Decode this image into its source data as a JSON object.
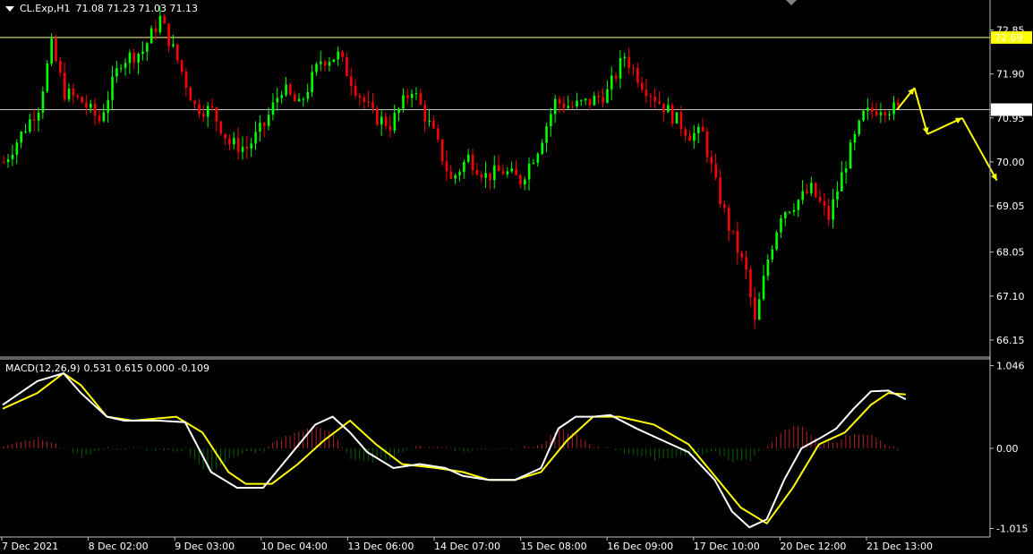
{
  "header": {
    "symbol_timeframe": "CL.Exp,H1",
    "ohlc": "71.08 71.23 71.03 71.13"
  },
  "macd_header": {
    "label": "MACD(12,26,9)",
    "values": "0.531 0.615 0.000 -0.109"
  },
  "colors": {
    "background": "#000000",
    "bull_candle": "#00ff00",
    "bear_candle": "#ff0000",
    "macd_line": "#ffffff",
    "signal_line": "#ffff00",
    "hist_pos": "#b22222",
    "hist_neg": "#006400",
    "level_line": "#ffff80",
    "price_line": "#c0c0c0",
    "arrow": "#ffff00"
  },
  "chart_data": [
    {
      "type": "candlestick",
      "symbol": "CL.Exp",
      "timeframe": "H1",
      "ylim": [
        65.8,
        73.5
      ],
      "y_ticks": [
        "72.85",
        "71.90",
        "70.95",
        "70.00",
        "69.05",
        "68.05",
        "67.10",
        "66.15"
      ],
      "y_tick_values": [
        72.85,
        71.9,
        70.95,
        70.0,
        69.05,
        68.05,
        67.1,
        66.15
      ],
      "x_ticks": [
        "7 Dec 2021",
        "8 Dec 02:00",
        "9 Dec 03:00",
        "10 Dec 04:00",
        "13 Dec 06:00",
        "14 Dec 07:00",
        "15 Dec 08:00",
        "16 Dec 09:00",
        "17 Dec 10:00",
        "20 Dec 12:00",
        "21 Dec 13:00"
      ],
      "horizontal_level": {
        "value": 72.69,
        "label": "72.69"
      },
      "current_price": {
        "value": 71.13,
        "label": "71.13"
      },
      "price_path": [
        [
          0,
          70.0
        ],
        [
          8,
          71.2
        ],
        [
          11,
          72.5
        ],
        [
          14,
          71.5
        ],
        [
          18,
          71.3
        ],
        [
          22,
          70.9
        ],
        [
          27,
          72.2
        ],
        [
          32,
          72.4
        ],
        [
          36,
          73.1
        ],
        [
          40,
          72.2
        ],
        [
          44,
          71.2
        ],
        [
          48,
          71.1
        ],
        [
          52,
          70.4
        ],
        [
          56,
          70.3
        ],
        [
          60,
          70.8
        ],
        [
          64,
          71.6
        ],
        [
          68,
          71.2
        ],
        [
          73,
          72.2
        ],
        [
          77,
          72.3
        ],
        [
          81,
          71.6
        ],
        [
          85,
          71.0
        ],
        [
          89,
          70.8
        ],
        [
          94,
          71.6
        ],
        [
          99,
          70.6
        ],
        [
          103,
          69.6
        ],
        [
          107,
          70.1
        ],
        [
          111,
          69.7
        ],
        [
          115,
          69.8
        ],
        [
          119,
          69.6
        ],
        [
          123,
          70.3
        ],
        [
          127,
          71.3
        ],
        [
          131,
          71.2
        ],
        [
          135,
          71.3
        ],
        [
          139,
          71.5
        ],
        [
          143,
          72.3
        ],
        [
          147,
          71.7
        ],
        [
          151,
          71.3
        ],
        [
          154,
          71.0
        ],
        [
          158,
          70.6
        ],
        [
          161,
          70.6
        ],
        [
          164,
          69.5
        ],
        [
          167,
          68.6
        ],
        [
          171,
          67.6
        ],
        [
          173,
          66.5
        ],
        [
          176,
          67.9
        ],
        [
          179,
          68.9
        ],
        [
          182,
          69.1
        ],
        [
          186,
          69.4
        ],
        [
          190,
          68.8
        ],
        [
          194,
          70.0
        ],
        [
          198,
          71.0
        ],
        [
          202,
          71.2
        ],
        [
          206,
          71.13
        ]
      ],
      "forecast_arrow": [
        [
          206,
          71.13
        ],
        [
          210,
          71.6
        ],
        [
          213,
          70.6
        ],
        [
          221,
          70.95
        ],
        [
          229,
          69.6
        ]
      ]
    },
    {
      "type": "macd",
      "params": [
        12,
        26,
        9
      ],
      "ylim": [
        -1.1,
        1.12
      ],
      "y_ticks": [
        "1.046",
        "0.00",
        "-1.015"
      ],
      "y_tick_values": [
        1.046,
        0.0,
        -1.015
      ],
      "macd_path": [
        [
          0,
          0.55
        ],
        [
          8,
          0.85
        ],
        [
          14,
          0.95
        ],
        [
          18,
          0.7
        ],
        [
          24,
          0.4
        ],
        [
          28,
          0.35
        ],
        [
          36,
          0.35
        ],
        [
          42,
          0.33
        ],
        [
          48,
          -0.3
        ],
        [
          54,
          -0.5
        ],
        [
          60,
          -0.5
        ],
        [
          66,
          -0.1
        ],
        [
          72,
          0.3
        ],
        [
          76,
          0.4
        ],
        [
          80,
          0.2
        ],
        [
          84,
          -0.05
        ],
        [
          90,
          -0.25
        ],
        [
          96,
          -0.2
        ],
        [
          102,
          -0.25
        ],
        [
          106,
          -0.35
        ],
        [
          112,
          -0.4
        ],
        [
          118,
          -0.4
        ],
        [
          124,
          -0.25
        ],
        [
          128,
          0.25
        ],
        [
          132,
          0.4
        ],
        [
          136,
          0.4
        ],
        [
          140,
          0.42
        ],
        [
          146,
          0.25
        ],
        [
          152,
          0.1
        ],
        [
          158,
          -0.05
        ],
        [
          164,
          -0.4
        ],
        [
          168,
          -0.8
        ],
        [
          172,
          -1.0
        ],
        [
          176,
          -0.9
        ],
        [
          180,
          -0.4
        ],
        [
          184,
          0.0
        ],
        [
          188,
          0.12
        ],
        [
          192,
          0.25
        ],
        [
          196,
          0.5
        ],
        [
          200,
          0.72
        ],
        [
          204,
          0.73
        ],
        [
          208,
          0.62
        ]
      ],
      "signal_path": [
        [
          0,
          0.5
        ],
        [
          8,
          0.7
        ],
        [
          14,
          0.95
        ],
        [
          18,
          0.8
        ],
        [
          24,
          0.4
        ],
        [
          30,
          0.35
        ],
        [
          40,
          0.4
        ],
        [
          46,
          0.2
        ],
        [
          52,
          -0.3
        ],
        [
          56,
          -0.45
        ],
        [
          62,
          -0.45
        ],
        [
          68,
          -0.2
        ],
        [
          74,
          0.1
        ],
        [
          80,
          0.35
        ],
        [
          86,
          0.05
        ],
        [
          92,
          -0.2
        ],
        [
          100,
          -0.25
        ],
        [
          106,
          -0.3
        ],
        [
          112,
          -0.4
        ],
        [
          118,
          -0.4
        ],
        [
          124,
          -0.3
        ],
        [
          130,
          0.1
        ],
        [
          136,
          0.4
        ],
        [
          142,
          0.4
        ],
        [
          150,
          0.3
        ],
        [
          158,
          0.05
        ],
        [
          164,
          -0.35
        ],
        [
          170,
          -0.75
        ],
        [
          176,
          -0.95
        ],
        [
          182,
          -0.5
        ],
        [
          188,
          0.05
        ],
        [
          194,
          0.2
        ],
        [
          200,
          0.55
        ],
        [
          204,
          0.7
        ],
        [
          208,
          0.68
        ]
      ]
    }
  ]
}
